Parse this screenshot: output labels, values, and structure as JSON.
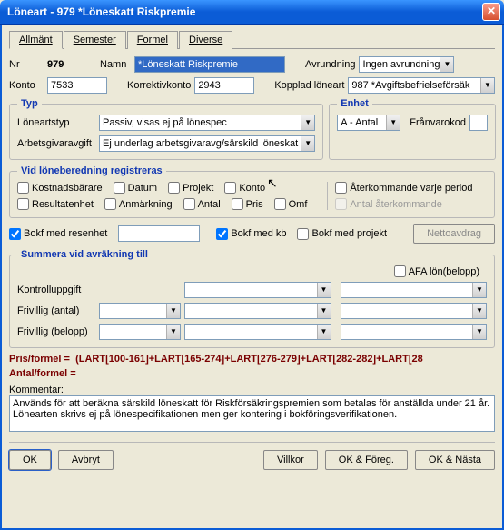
{
  "window": {
    "title": "Löneart - 979  *Löneskatt Riskpremie"
  },
  "tabs": [
    "Allmänt",
    "Semester",
    "Formel",
    "Diverse"
  ],
  "header": {
    "nr_lbl": "Nr",
    "nr_val": "979",
    "namn_lbl": "Namn",
    "namn_val": "*Löneskatt Riskpremie",
    "avr_lbl": "Avrundning",
    "avr_val": "Ingen avrundning",
    "konto_lbl": "Konto",
    "konto_val": "7533",
    "korr_lbl": "Korrektivkonto",
    "korr_val": "2943",
    "kopp_lbl": "Kopplad löneart",
    "kopp_val": "987 *Avgiftsbefrielseförsäk"
  },
  "typ": {
    "legend": "Typ",
    "lonearts_lbl": "Löneartstyp",
    "lonearts_val": "Passiv, visas ej på lönespec",
    "arbavg_lbl": "Arbetsgivaravgift",
    "arbavg_val": "Ej underlag arbetsgivaravg/särskild löneskat"
  },
  "enhet": {
    "legend": "Enhet",
    "val": "A - Antal",
    "franvaro_lbl": "Frånvarokod",
    "franvaro_val": ""
  },
  "vidreg": {
    "legend": "Vid löneberedning registreras",
    "cb1": "Kostnadsbärare",
    "cb2": "Datum",
    "cb3": "Projekt",
    "cb4": "Konto",
    "cb5": "Resultatenhet",
    "cb6": "Anmärkning",
    "cb7": "Antal",
    "cb8": "Pris",
    "cb9": "Omf",
    "cb_right1": "Återkommande varje period",
    "cb_right2": "Antal återkommande"
  },
  "bokf": {
    "cb_res": "Bokf med resenhet",
    "res_val": "",
    "cb_kb": "Bokf med kb",
    "cb_proj": "Bokf med projekt",
    "netto_btn": "Nettoavdrag"
  },
  "summera": {
    "legend": "Summera vid avräkning till",
    "afa_cb": "AFA lön(belopp)",
    "ku_lbl": "Kontrolluppgift",
    "fa_lbl": "Frivillig (antal)",
    "fb_lbl": "Frivillig (belopp)"
  },
  "formel": {
    "pris_lbl": "Pris/formel =",
    "pris_val": "(LART[100-161]+LART[165-274]+LART[276-279]+LART[282-282]+LART[28",
    "antal_lbl": "Antal/formel ="
  },
  "kommentar": {
    "lbl": "Kommentar:",
    "val": "Används för att beräkna särskild löneskatt för Riskförsäkringspremien som betalas för anställda under 21 år. Lönearten skrivs ej på lönespecifikationen men ger kontering i bokföringsverifikationen."
  },
  "buttons": {
    "ok": "OK",
    "avbryt": "Avbryt",
    "villkor": "Villkor",
    "okforeg": "OK & Föreg.",
    "oknasta": "OK & Nästa"
  }
}
